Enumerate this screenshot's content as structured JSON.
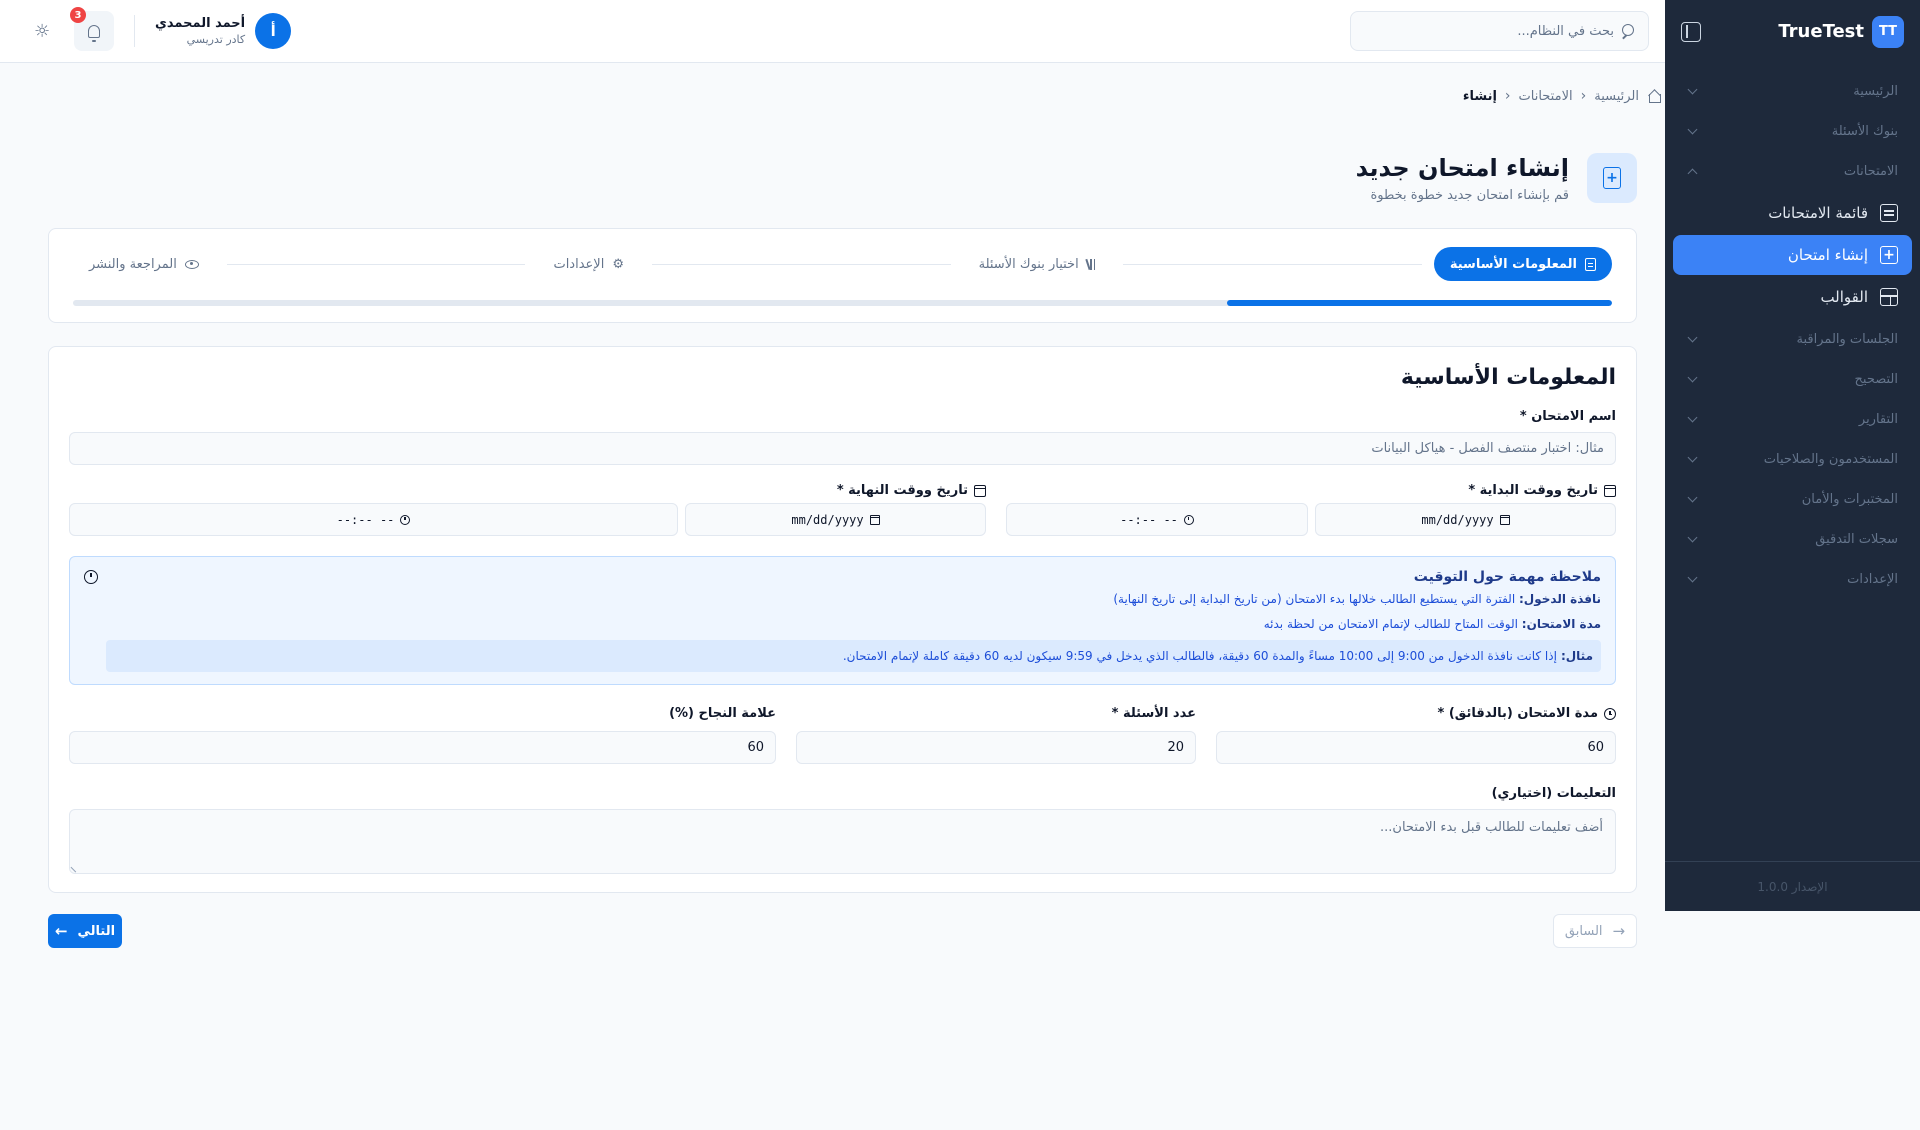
{
  "sidebar": {
    "brand_logo": "TT",
    "brand_name": "TrueTest",
    "groups": [
      {
        "label": "الرئيسية"
      },
      {
        "label": "بنوك الأسئلة"
      },
      {
        "label": "الامتحانات"
      }
    ],
    "exam_items": [
      {
        "label": "قائمة الامتحانات",
        "icon": "document-icon"
      },
      {
        "label": "إنشاء امتحان",
        "icon": "document-plus-icon",
        "active": true
      },
      {
        "label": "القوالب",
        "icon": "layout-icon"
      }
    ],
    "groups_after": [
      {
        "label": "الجلسات والمراقبة"
      },
      {
        "label": "التصحيح"
      },
      {
        "label": "التقارير"
      },
      {
        "label": "المستخدمون والصلاحيات"
      },
      {
        "label": "المختبرات والأمان"
      },
      {
        "label": "سجلات التدقيق"
      },
      {
        "label": "الإعدادات"
      }
    ],
    "version": "الإصدار 1.0.0"
  },
  "topbar": {
    "search_placeholder": "بحث في النظام...",
    "notification_count": "3",
    "user": {
      "initial": "أ",
      "name": "أحمد المحمدي",
      "role": "كادر تدريسي"
    }
  },
  "breadcrumb": {
    "home": "الرئيسية",
    "exams": "الامتحانات",
    "current": "إنشاء"
  },
  "page": {
    "title": "إنشاء امتحان جديد",
    "subtitle": "قم بإنشاء امتحان جديد خطوة بخطوة"
  },
  "stepper": {
    "steps": [
      {
        "label": "المعلومات الأساسية",
        "active": true
      },
      {
        "label": "اختيار بنوك الأسئلة"
      },
      {
        "label": "الإعدادات"
      },
      {
        "label": "المراجعة والنشر"
      }
    ],
    "progress_fraction": 0.25
  },
  "form": {
    "section_title": "المعلومات الأساسية",
    "exam_name_label": "اسم الامتحان *",
    "exam_name_placeholder": "مثال: اختبار منتصف الفصل - هياكل البيانات",
    "start_label": "تاريخ ووقت البداية *",
    "end_label": "تاريخ ووقت النهاية *",
    "date_placeholder": "mm/dd/yyyy",
    "time_placeholder": "--:-- --",
    "note": {
      "title": "ملاحظة مهمة حول التوقيت",
      "window_label": "نافذة الدخول:",
      "window_text": "الفترة التي يستطيع الطالب خلالها بدء الامتحان (من تاريخ البداية إلى تاريخ النهاية)",
      "duration_label": "مدة الامتحان:",
      "duration_text": "الوقت المتاح للطالب لإتمام الامتحان من لحظة بدئه",
      "example_label": "مثال:",
      "example_text": "إذا كانت نافذة الدخول من 9:00 إلى 10:00 مساءً والمدة 60 دقيقة، فالطالب الذي يدخل في 9:59 سيكون لديه 60 دقيقة كاملة لإتمام الامتحان."
    },
    "duration_label": "مدة الامتحان (بالدقائق) *",
    "duration_value": "60",
    "questions_label": "عدد الأسئلة *",
    "questions_value": "20",
    "pass_label": "علامة النجاح (%)",
    "pass_value": "60",
    "instructions_label": "التعليمات (اختياري)",
    "instructions_placeholder": "أضف تعليمات للطالب قبل بدء الامتحان..."
  },
  "actions": {
    "next": "التالي",
    "previous": "السابق"
  },
  "colors": {
    "primary": "#0b72e7",
    "sidebar_bg": "#1e293b",
    "note_bg": "#eff6ff",
    "badge": "#ef4444"
  }
}
